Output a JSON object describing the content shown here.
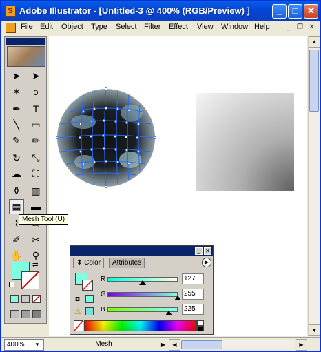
{
  "window": {
    "title": "Adobe Illustrator - [Untitled-3 @ 400% (RGB/Preview) ]",
    "app_icon_letter": "S",
    "minimize_glyph": "_",
    "maximize_glyph": "□",
    "close_glyph": "✕"
  },
  "menubar": {
    "items": [
      {
        "label": "File"
      },
      {
        "label": "Edit"
      },
      {
        "label": "Object"
      },
      {
        "label": "Type"
      },
      {
        "label": "Select"
      },
      {
        "label": "Filter"
      },
      {
        "label": "Effect"
      },
      {
        "label": "View"
      },
      {
        "label": "Window"
      },
      {
        "label": "Help"
      }
    ],
    "doc_minimize": "_",
    "doc_restore": "❐",
    "doc_close": "✕"
  },
  "toolbox": {
    "tools": [
      {
        "name": "selection-tool-icon",
        "glyph": "➤"
      },
      {
        "name": "direct-selection-tool-icon",
        "glyph": "➤"
      },
      {
        "name": "magic-wand-tool-icon",
        "glyph": "✶"
      },
      {
        "name": "lasso-tool-icon",
        "glyph": "ↄ"
      },
      {
        "name": "pen-tool-icon",
        "glyph": "✒"
      },
      {
        "name": "type-tool-icon",
        "glyph": "T"
      },
      {
        "name": "line-tool-icon",
        "glyph": "╲"
      },
      {
        "name": "rectangle-tool-icon",
        "glyph": "▭"
      },
      {
        "name": "paintbrush-tool-icon",
        "glyph": "✎"
      },
      {
        "name": "pencil-tool-icon",
        "glyph": "✏"
      },
      {
        "name": "rotate-tool-icon",
        "glyph": "↻"
      },
      {
        "name": "scale-tool-icon",
        "glyph": "⤡"
      },
      {
        "name": "warp-tool-icon",
        "glyph": "☁"
      },
      {
        "name": "free-transform-tool-icon",
        "glyph": "⛶"
      },
      {
        "name": "symbol-sprayer-tool-icon",
        "glyph": "⚱"
      },
      {
        "name": "column-graph-tool-icon",
        "glyph": "▥"
      },
      {
        "name": "mesh-tool-icon",
        "glyph": "▦"
      },
      {
        "name": "gradient-tool-icon",
        "glyph": "▬"
      },
      {
        "name": "eyedropper-tool-icon",
        "glyph": "⌇"
      },
      {
        "name": "blend-tool-icon",
        "glyph": "⧉"
      },
      {
        "name": "slice-tool-icon",
        "glyph": "✐"
      },
      {
        "name": "scissors-tool-icon",
        "glyph": "✂"
      },
      {
        "name": "hand-tool-icon",
        "glyph": "✋"
      },
      {
        "name": "zoom-tool-icon",
        "glyph": "⚲"
      }
    ]
  },
  "tooltip": {
    "text": "Mesh Tool (U)"
  },
  "color_panel": {
    "tabs": [
      {
        "label": "Color"
      },
      {
        "label": "Attributes"
      }
    ],
    "channels": [
      {
        "label": "R",
        "value": "127"
      },
      {
        "label": "G",
        "value": "255"
      },
      {
        "label": "B",
        "value": "225"
      }
    ],
    "fill_color": "#7fffe1",
    "menu_glyph": "▶",
    "minimize_glyph": "_",
    "close_glyph": "✕"
  },
  "status": {
    "zoom": "400%",
    "tool": "Mesh"
  },
  "colors": {
    "titlebar": "#0a5ee8",
    "fill_swatch": "#7fffe1",
    "mesh_lines": "#2a6af0"
  }
}
